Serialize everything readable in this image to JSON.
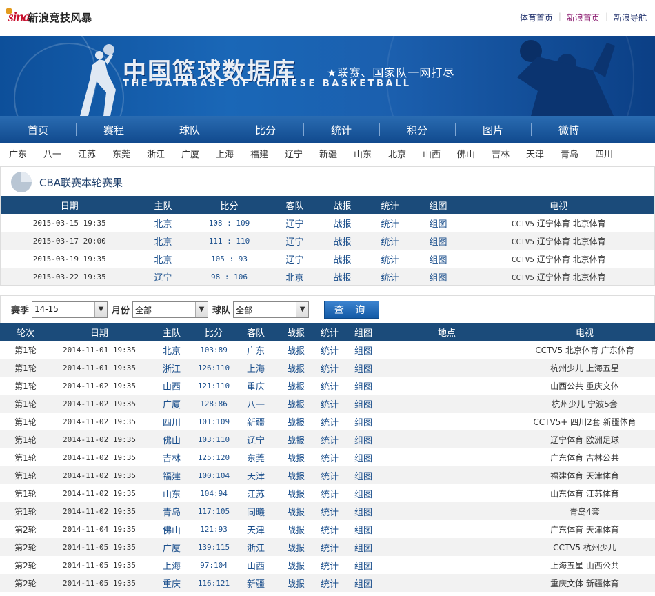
{
  "top": {
    "logo_mark": "sina",
    "site_name": "新浪竞技风暴",
    "links": [
      {
        "label": "体育首页",
        "active": false
      },
      {
        "label": "新浪首页",
        "active": true
      },
      {
        "label": "新浪导航",
        "active": false
      }
    ],
    "separator": "|"
  },
  "banner": {
    "title": "中国篮球数据库",
    "subtitle": "THE DATABASE OF CHINESE BASKETBALL",
    "slogan": "★联赛、国家队一网打尽"
  },
  "main_nav": [
    "首页",
    "赛程",
    "球队",
    "比分",
    "统计",
    "积分",
    "图片",
    "微博"
  ],
  "team_nav": [
    "广东",
    "八一",
    "江苏",
    "东莞",
    "浙江",
    "广厦",
    "上海",
    "福建",
    "辽宁",
    "新疆",
    "山东",
    "北京",
    "山西",
    "佛山",
    "吉林",
    "天津",
    "青岛",
    "四川"
  ],
  "recent": {
    "title": "CBA联赛本轮赛果",
    "headers": [
      "日期",
      "主队",
      "比分",
      "客队",
      "战报",
      "统计",
      "组图",
      "电视"
    ],
    "rows": [
      {
        "date": "2015-03-15 19:35",
        "home": "北京",
        "score": "108 : 109",
        "away": "辽宁",
        "report": "战报",
        "stats": "统计",
        "photos": "组图",
        "tv_code": "CCTV5",
        "tv": "辽宁体育 北京体育"
      },
      {
        "date": "2015-03-17 20:00",
        "home": "北京",
        "score": "111 : 110",
        "away": "辽宁",
        "report": "战报",
        "stats": "统计",
        "photos": "组图",
        "tv_code": "CCTV5",
        "tv": "辽宁体育 北京体育"
      },
      {
        "date": "2015-03-19 19:35",
        "home": "北京",
        "score": "105 : 93",
        "away": "辽宁",
        "report": "战报",
        "stats": "统计",
        "photos": "组图",
        "tv_code": "CCTV5",
        "tv": "辽宁体育 北京体育"
      },
      {
        "date": "2015-03-22 19:35",
        "home": "辽宁",
        "score": "98 : 106",
        "away": "北京",
        "report": "战报",
        "stats": "统计",
        "photos": "组图",
        "tv_code": "CCTV5",
        "tv": "辽宁体育 北京体育"
      }
    ]
  },
  "filter": {
    "season_label": "赛季",
    "season_value": "14-15",
    "month_label": "月份",
    "month_value": "全部",
    "team_label": "球队",
    "team_value": "全部",
    "query_label": "查 询"
  },
  "schedule": {
    "headers": [
      "轮次",
      "日期",
      "主队",
      "比分",
      "客队",
      "战报",
      "统计",
      "组图",
      "地点",
      "电视"
    ],
    "rows": [
      {
        "round": "第1轮",
        "date": "2014-11-01 19:35",
        "home": "北京",
        "score": "103:89",
        "away": "广东",
        "report": "战报",
        "stats": "统计",
        "photos": "组图",
        "venue": "",
        "tv": "CCTV5 北京体育 广东体育"
      },
      {
        "round": "第1轮",
        "date": "2014-11-01 19:35",
        "home": "浙江",
        "score": "126:110",
        "away": "上海",
        "report": "战报",
        "stats": "统计",
        "photos": "组图",
        "venue": "",
        "tv": "杭州少儿 上海五星"
      },
      {
        "round": "第1轮",
        "date": "2014-11-02 19:35",
        "home": "山西",
        "score": "121:110",
        "away": "重庆",
        "report": "战报",
        "stats": "统计",
        "photos": "组图",
        "venue": "",
        "tv": "山西公共 重庆文体"
      },
      {
        "round": "第1轮",
        "date": "2014-11-02 19:35",
        "home": "广厦",
        "score": "128:86",
        "away": "八一",
        "report": "战报",
        "stats": "统计",
        "photos": "组图",
        "venue": "",
        "tv": "杭州少儿 宁波5套"
      },
      {
        "round": "第1轮",
        "date": "2014-11-02 19:35",
        "home": "四川",
        "score": "101:109",
        "away": "新疆",
        "report": "战报",
        "stats": "统计",
        "photos": "组图",
        "venue": "",
        "tv": "CCTV5+ 四川2套 新疆体育"
      },
      {
        "round": "第1轮",
        "date": "2014-11-02 19:35",
        "home": "佛山",
        "score": "103:110",
        "away": "辽宁",
        "report": "战报",
        "stats": "统计",
        "photos": "组图",
        "venue": "",
        "tv": "辽宁体育 欧洲足球"
      },
      {
        "round": "第1轮",
        "date": "2014-11-02 19:35",
        "home": "吉林",
        "score": "125:120",
        "away": "东莞",
        "report": "战报",
        "stats": "统计",
        "photos": "组图",
        "venue": "",
        "tv": "广东体育 吉林公共"
      },
      {
        "round": "第1轮",
        "date": "2014-11-02 19:35",
        "home": "福建",
        "score": "100:104",
        "away": "天津",
        "report": "战报",
        "stats": "统计",
        "photos": "组图",
        "venue": "",
        "tv": "福建体育 天津体育"
      },
      {
        "round": "第1轮",
        "date": "2014-11-02 19:35",
        "home": "山东",
        "score": "104:94",
        "away": "江苏",
        "report": "战报",
        "stats": "统计",
        "photos": "组图",
        "venue": "",
        "tv": "山东体育 江苏体育"
      },
      {
        "round": "第1轮",
        "date": "2014-11-02 19:35",
        "home": "青岛",
        "score": "117:105",
        "away": "同曦",
        "report": "战报",
        "stats": "统计",
        "photos": "组图",
        "venue": "",
        "tv": "青岛4套"
      },
      {
        "round": "第2轮",
        "date": "2014-11-04 19:35",
        "home": "佛山",
        "score": "121:93",
        "away": "天津",
        "report": "战报",
        "stats": "统计",
        "photos": "组图",
        "venue": "",
        "tv": "广东体育 天津体育"
      },
      {
        "round": "第2轮",
        "date": "2014-11-05 19:35",
        "home": "广厦",
        "score": "139:115",
        "away": "浙江",
        "report": "战报",
        "stats": "统计",
        "photos": "组图",
        "venue": "",
        "tv": "CCTV5 杭州少儿"
      },
      {
        "round": "第2轮",
        "date": "2014-11-05 19:35",
        "home": "上海",
        "score": "97:104",
        "away": "山西",
        "report": "战报",
        "stats": "统计",
        "photos": "组图",
        "venue": "",
        "tv": "上海五星 山西公共"
      },
      {
        "round": "第2轮",
        "date": "2014-11-05 19:35",
        "home": "重庆",
        "score": "116:121",
        "away": "新疆",
        "report": "战报",
        "stats": "统计",
        "photos": "组图",
        "venue": "",
        "tv": "重庆文体 新疆体育"
      }
    ]
  },
  "colors": {
    "nav_blue": "#10498d",
    "table_header": "#1b4b7a",
    "link": "#1b4f8c",
    "row_alt": "#f2f2f2"
  }
}
